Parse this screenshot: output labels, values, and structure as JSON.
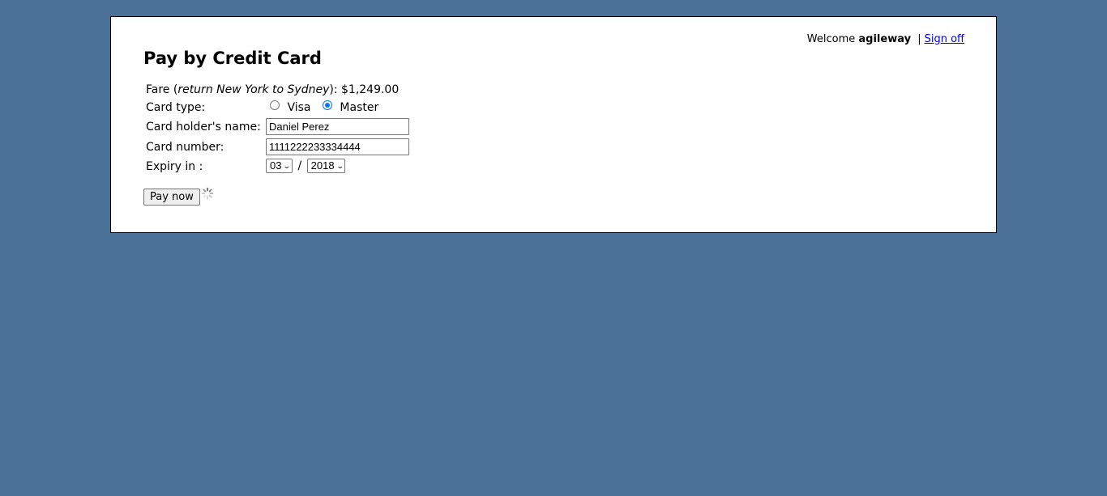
{
  "header": {
    "welcome_prefix": "Welcome",
    "username": "agileway",
    "separator": "|",
    "sign_off": "Sign off"
  },
  "page": {
    "title": "Pay by Credit Card"
  },
  "fare": {
    "label_prefix": "Fare (",
    "route": "return New York to Sydney",
    "label_suffix": "):",
    "amount": "$1,249.00"
  },
  "card_type": {
    "label": "Card type:",
    "options": [
      "Visa",
      "Master"
    ],
    "selected": "Master"
  },
  "holder_name": {
    "label": "Card holder's name:",
    "value": "Daniel Perez"
  },
  "card_number": {
    "label": "Card number:",
    "value": "1111222233334444"
  },
  "expiry": {
    "label": "Expiry in :",
    "month": "03",
    "separator": "/",
    "year": "2018"
  },
  "actions": {
    "pay_now": "Pay now",
    "loading_icon": "spinner-icon"
  },
  "colors": {
    "background": "#4b7198",
    "panel": "#ffffff",
    "link": "#0000ee",
    "radio_accent": "#0075ff"
  }
}
